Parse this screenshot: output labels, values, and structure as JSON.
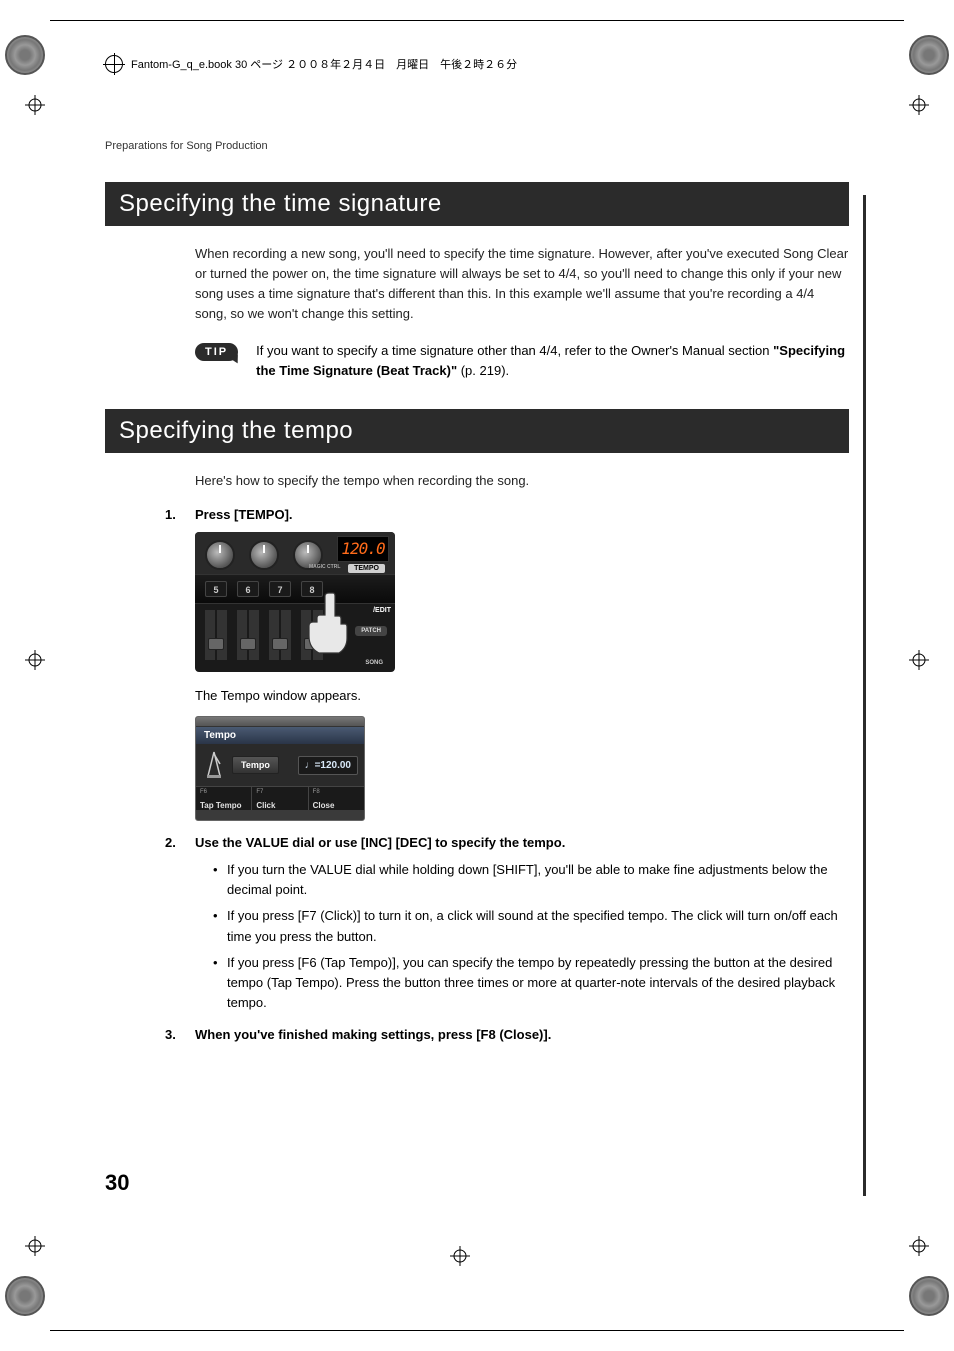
{
  "header_meta": "Fantom-G_q_e.book  30 ページ  ２００８年２月４日　月曜日　午後２時２６分",
  "breadcrumb": "Preparations for Song Production",
  "section1": {
    "title": "Specifying the time signature",
    "body": "When recording a new song, you'll need to specify the time signature. However, after you've executed Song Clear or turned the power on, the time signature will always be set to 4/4, so you'll need to change this only if your new song uses a time signature that's different than this. In this example we'll assume that you're recording a 4/4 song, so we won't change this setting.",
    "tip_badge": "TIP",
    "tip_text_pre": "If you want to specify a time signature other than 4/4, refer to the Owner's Manual section ",
    "tip_text_bold": "\"Specifying the Time Signature (Beat Track)\"",
    "tip_text_post": " (p. 219)."
  },
  "section2": {
    "title": "Specifying the tempo",
    "intro": "Here's how to specify the tempo when recording the song.",
    "steps": [
      {
        "num": "1.",
        "title": "Press [TEMPO].",
        "after_figure": "The Tempo window appears."
      },
      {
        "num": "2.",
        "title": "Use the VALUE dial or use [INC] [DEC] to specify the tempo.",
        "bullets": [
          "If you turn the VALUE dial while holding down [SHIFT], you'll be able to make fine adjustments below the decimal point.",
          "If you press [F7 (Click)] to turn it on, a click will sound at the specified tempo. The click will turn on/off each time you press the button.",
          "If you press [F6 (Tap Tempo)], you can specify the tempo by repeatedly pressing the button at the desired tempo (Tap Tempo). Press the button three times or more at quarter-note intervals of the desired playback tempo."
        ]
      },
      {
        "num": "3.",
        "title": "When you've finished making settings, press [F8 (Close)]."
      }
    ]
  },
  "figure_panel": {
    "tempo_display": "120.0",
    "tempo_label": "TEMPO",
    "magic_ctrl": "MAGIC CTRL",
    "numbers": [
      "5",
      "6",
      "7",
      "8"
    ],
    "edit": "/EDIT",
    "patch": "PATCH",
    "song": "SONG"
  },
  "tempo_window": {
    "header": "Tempo",
    "field_label": "Tempo",
    "field_value": "♩=120.00",
    "fkeys": [
      {
        "num": "F6",
        "label": "Tap Tempo"
      },
      {
        "num": "F7",
        "label": "Click"
      },
      {
        "num": "F8",
        "label": "Close"
      }
    ]
  },
  "page_number": "30"
}
